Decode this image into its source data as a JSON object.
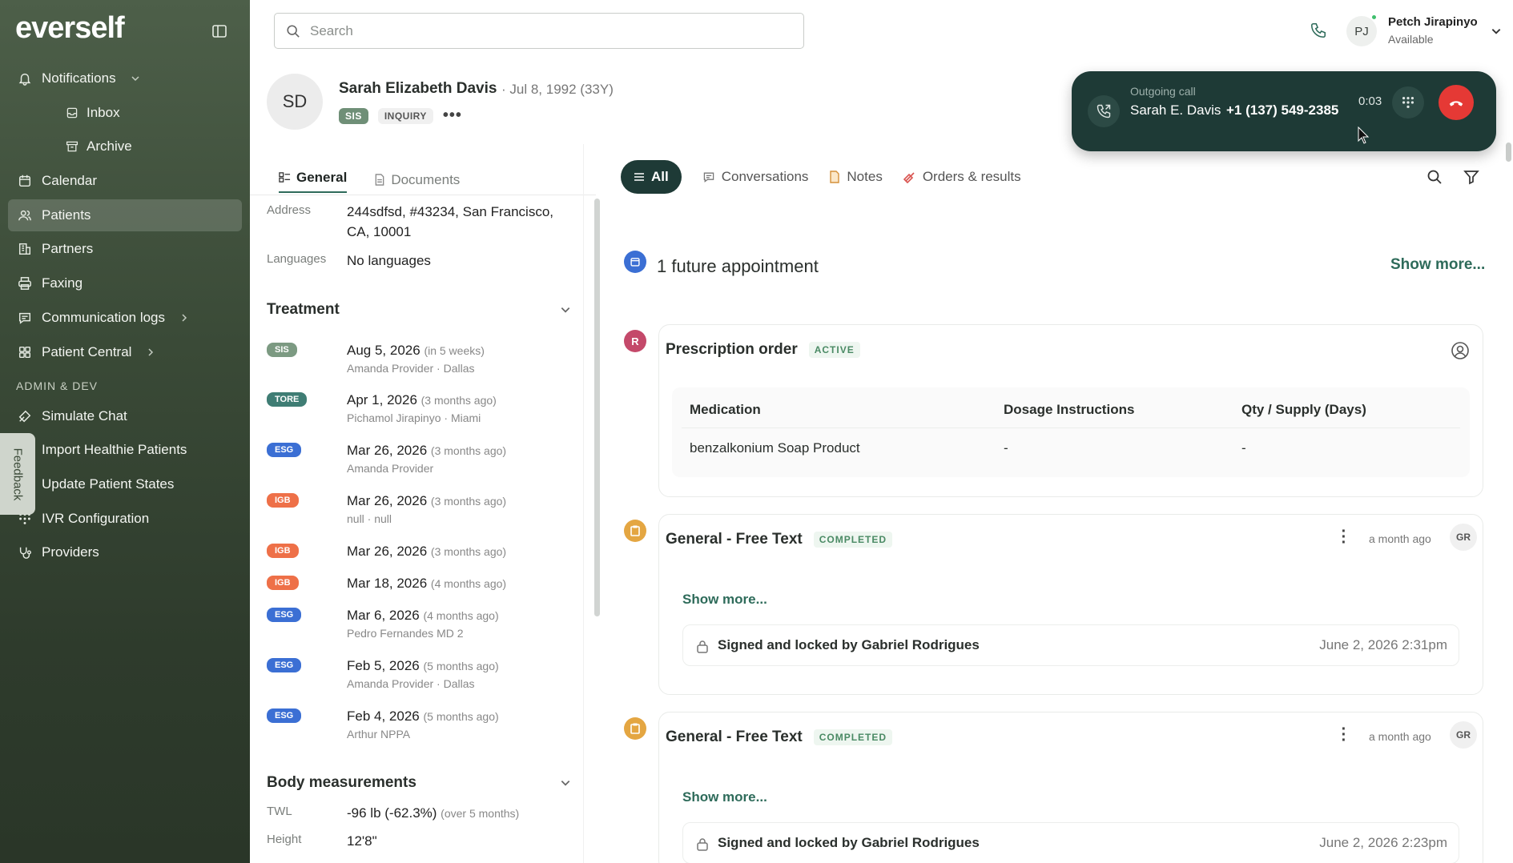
{
  "brand": "everself",
  "sidebar": {
    "items": [
      {
        "label": "Notifications"
      },
      {
        "label": "Inbox"
      },
      {
        "label": "Archive"
      },
      {
        "label": "Calendar"
      },
      {
        "label": "Patients"
      },
      {
        "label": "Partners"
      },
      {
        "label": "Faxing"
      },
      {
        "label": "Communication logs"
      },
      {
        "label": "Patient Central"
      }
    ],
    "section_label": "ADMIN & DEV",
    "admin_items": [
      {
        "label": "Simulate Chat"
      },
      {
        "label": "Import Healthie Patients"
      },
      {
        "label": "Update Patient States"
      },
      {
        "label": "IVR Configuration"
      },
      {
        "label": "Providers"
      }
    ],
    "feedback": "Feedback"
  },
  "topbar": {
    "search_placeholder": "Search",
    "user_initials": "PJ",
    "user_name": "Petch Jirapinyo",
    "user_status": "Available"
  },
  "patient": {
    "initials": "SD",
    "name": "Sarah Elizabeth Davis",
    "dob": "· Jul 8, 1992 (33Y)",
    "tags": [
      "SIS",
      "INQUIRY"
    ],
    "more": "•••"
  },
  "call": {
    "label": "Outgoing call",
    "name": "Sarah E. Davis",
    "number": "+1 (137) 549-2385",
    "timer": "0:03"
  },
  "left": {
    "tabs": [
      "General",
      "Documents"
    ],
    "address_label": "Address",
    "address_value": "244sdfsd, #43234, San Francisco, CA, 10001",
    "languages_label": "Languages",
    "languages_value": "No languages",
    "treatment_title": "Treatment",
    "treatments": [
      {
        "badge": "SIS",
        "date": "Aug 5, 2026",
        "rel": "(in 5 weeks)",
        "provider": "Amanda Provider · Dallas"
      },
      {
        "badge": "TORE",
        "date": "Apr 1, 2026",
        "rel": "(3 months ago)",
        "provider": "Pichamol Jirapinyo · Miami"
      },
      {
        "badge": "ESG",
        "date": "Mar 26, 2026",
        "rel": "(3 months ago)",
        "provider": "Amanda Provider"
      },
      {
        "badge": "IGB",
        "date": "Mar 26, 2026",
        "rel": "(3 months ago)",
        "provider": "null · null"
      },
      {
        "badge": "IGB",
        "date": "Mar 26, 2026",
        "rel": "(3 months ago)",
        "provider": ""
      },
      {
        "badge": "IGB",
        "date": "Mar 18, 2026",
        "rel": "(4 months ago)",
        "provider": ""
      },
      {
        "badge": "ESG",
        "date": "Mar 6, 2026",
        "rel": "(4 months ago)",
        "provider": "Pedro Fernandes MD 2"
      },
      {
        "badge": "ESG",
        "date": "Feb 5, 2026",
        "rel": "(5 months ago)",
        "provider": "Amanda Provider · Dallas"
      },
      {
        "badge": "ESG",
        "date": "Feb 4, 2026",
        "rel": "(5 months ago)",
        "provider": "Arthur NPPA"
      }
    ],
    "body_title": "Body measurements",
    "twl_label": "TWL",
    "twl_value": "-96 lb (-62.3%)",
    "twl_note": "(over 5 months)",
    "height_label": "Height",
    "height_value": "12'8\""
  },
  "right": {
    "filters": [
      "All",
      "Conversations",
      "Notes",
      "Orders & results"
    ],
    "future_appt": "1 future appointment",
    "show_more": "Show more...",
    "rx": {
      "icon_letter": "R",
      "title": "Prescription order",
      "status": "ACTIVE",
      "headers": [
        "Medication",
        "Dosage Instructions",
        "Qty / Supply (Days)"
      ],
      "row": [
        "benzalkonium Soap Product",
        "-",
        "-"
      ]
    },
    "notes": [
      {
        "title": "General - Free Text",
        "status": "COMPLETED",
        "time": "a month ago",
        "initials": "GR",
        "show_more": "Show more...",
        "signed": "Signed and locked by Gabriel Rodrigues",
        "signed_date": "June 2, 2026 2:31pm"
      },
      {
        "title": "General - Free Text",
        "status": "COMPLETED",
        "time": "a month ago",
        "initials": "GR",
        "show_more": "Show more...",
        "signed": "Signed and locked by Gabriel Rodrigues",
        "signed_date": "June 2, 2026 2:23pm"
      }
    ]
  },
  "colors": {
    "sidebar_top": "#4d5f49",
    "sidebar_bottom": "#2a3628",
    "accent": "#2e6b5a",
    "call_bg": "#1e3a36",
    "end_call": "#e53935"
  }
}
